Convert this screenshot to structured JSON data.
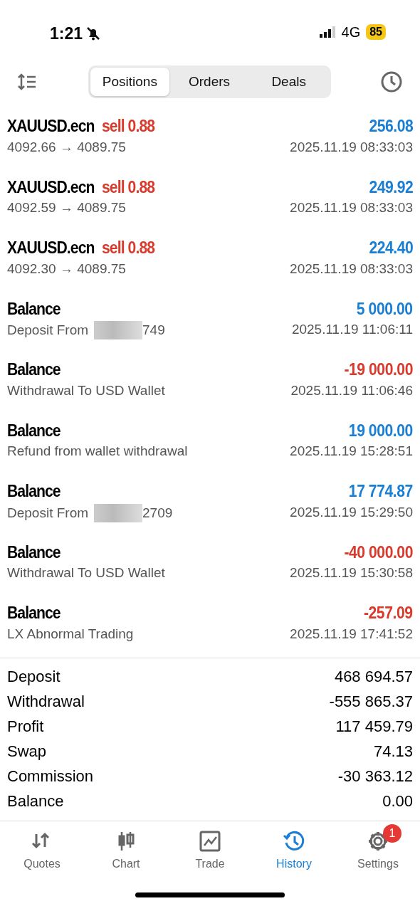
{
  "status_bar": {
    "time": "1:21",
    "network": "4G",
    "battery": "85"
  },
  "segments": [
    {
      "label": "Positions",
      "selected": true
    },
    {
      "label": "Orders",
      "selected": false
    },
    {
      "label": "Deals",
      "selected": false
    }
  ],
  "deals": [
    {
      "kind": "trade",
      "symbol": "XAUUSD.ecn",
      "side": "sell",
      "volume": "0.88",
      "prices": "4092.66 → 4089.75",
      "amount": "256.08",
      "negative": false,
      "time": "2025.11.19 08:33:03"
    },
    {
      "kind": "trade",
      "symbol": "XAUUSD.ecn",
      "side": "sell",
      "volume": "0.88",
      "prices": "4092.59 → 4089.75",
      "amount": "249.92",
      "negative": false,
      "time": "2025.11.19 08:33:03"
    },
    {
      "kind": "trade",
      "symbol": "XAUUSD.ecn",
      "side": "sell",
      "volume": "0.88",
      "prices": "4092.30 → 4089.75",
      "amount": "224.40",
      "negative": false,
      "time": "2025.11.19 08:33:03"
    },
    {
      "kind": "balance",
      "title": "Balance",
      "comment": "Deposit From",
      "redacted": true,
      "comment_tail": "749",
      "amount": "5 000.00",
      "negative": false,
      "time": "2025.11.19 11:06:11"
    },
    {
      "kind": "balance",
      "title": "Balance",
      "comment": "Withdrawal To USD Wallet",
      "redacted": false,
      "amount": "-19 000.00",
      "negative": true,
      "time": "2025.11.19 11:06:46"
    },
    {
      "kind": "balance",
      "title": "Balance",
      "comment": "Refund from wallet withdrawal",
      "redacted": false,
      "amount": "19 000.00",
      "negative": false,
      "time": "2025.11.19 15:28:51"
    },
    {
      "kind": "balance",
      "title": "Balance",
      "comment": "Deposit From",
      "redacted": true,
      "comment_tail": "2709",
      "amount": "17 774.87",
      "negative": false,
      "time": "2025.11.19 15:29:50"
    },
    {
      "kind": "balance",
      "title": "Balance",
      "comment": "Withdrawal To USD Wallet",
      "redacted": false,
      "amount": "-40 000.00",
      "negative": true,
      "time": "2025.11.19 15:30:58"
    },
    {
      "kind": "balance",
      "title": "Balance",
      "comment": "LX Abnormal Trading",
      "redacted": false,
      "amount": "-257.09",
      "negative": true,
      "time": "2025.11.19 17:41:52"
    }
  ],
  "summary": [
    {
      "label": "Deposit",
      "value": "468 694.57"
    },
    {
      "label": "Withdrawal",
      "value": "-555 865.37"
    },
    {
      "label": "Profit",
      "value": "117 459.79"
    },
    {
      "label": "Swap",
      "value": "74.13"
    },
    {
      "label": "Commission",
      "value": "-30 363.12"
    },
    {
      "label": "Balance",
      "value": "0.00"
    }
  ],
  "tab_bar": [
    {
      "label": "Quotes",
      "selected": false
    },
    {
      "label": "Chart",
      "selected": false
    },
    {
      "label": "Trade",
      "selected": false
    },
    {
      "label": "History",
      "selected": true
    },
    {
      "label": "Settings",
      "selected": false,
      "badge": "1"
    }
  ]
}
